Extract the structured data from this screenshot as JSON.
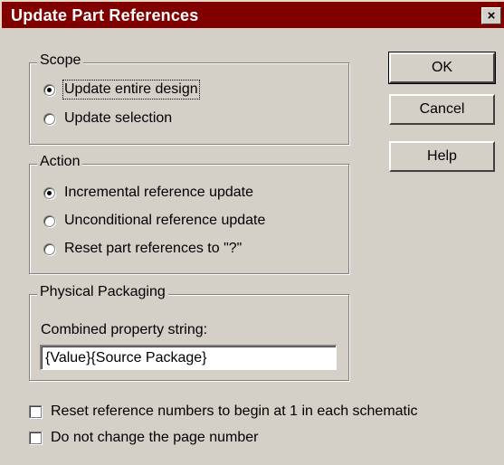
{
  "window": {
    "title": "Update Part References",
    "close_glyph": "×"
  },
  "scope": {
    "legend": "Scope",
    "options": [
      {
        "label": "Update entire design",
        "selected": true
      },
      {
        "label": "Update selection",
        "selected": false
      }
    ]
  },
  "action": {
    "legend": "Action",
    "options": [
      {
        "label": "Incremental reference update",
        "selected": true
      },
      {
        "label": "Unconditional reference update",
        "selected": false
      },
      {
        "label": "Reset part references to \"?\"",
        "selected": false
      }
    ]
  },
  "packaging": {
    "legend": "Physical Packaging",
    "field_label": "Combined property string:",
    "field_value": "{Value}{Source Package}"
  },
  "checkboxes": [
    {
      "label": "Reset reference numbers to begin at 1 in each schematic",
      "checked": false
    },
    {
      "label": "Do not change the page number",
      "checked": false
    }
  ],
  "buttons": {
    "ok": "OK",
    "cancel": "Cancel",
    "help": "Help"
  }
}
